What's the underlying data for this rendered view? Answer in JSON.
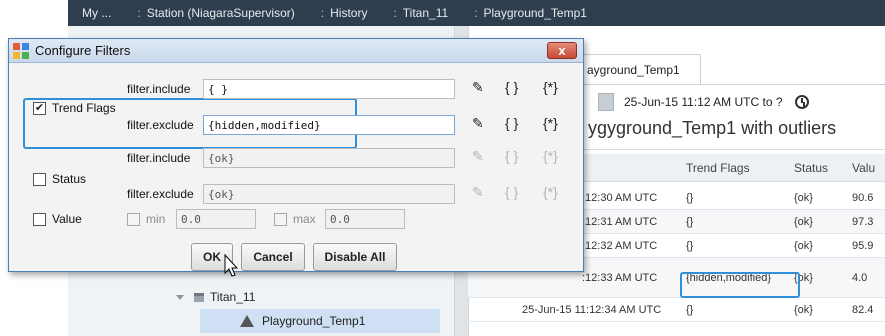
{
  "breadcrumbs": [
    {
      "label": "My ..."
    },
    {
      "label": "Station (NiagaraSupervisor)"
    },
    {
      "label": "History"
    },
    {
      "label": "Titan_11"
    },
    {
      "label": "Playground_Temp1"
    }
  ],
  "breadcrumb_separator": ":",
  "nav_tree": {
    "parent": "Titan_11",
    "selected": "Playground_Temp1"
  },
  "main": {
    "tab_label": "ayground_Temp1",
    "range_text": "25-Jun-15 11:12 AM UTC to ?",
    "chart_title": "ygyground_Temp1 with outliers",
    "columns": [
      "Trend Flags",
      "Status",
      "Valu"
    ],
    "rows": [
      {
        "timestamp": ":12:30 AM UTC",
        "flags": "{}",
        "status": "{ok}",
        "value": "90.6"
      },
      {
        "timestamp": ":12:31 AM UTC",
        "flags": "{}",
        "status": "{ok}",
        "value": "97.3"
      },
      {
        "timestamp": ":12:32 AM UTC",
        "flags": "{}",
        "status": "{ok}",
        "value": "95.9"
      },
      {
        "timestamp": ":12:33 AM UTC",
        "flags": "{hidden,modified}",
        "status": "{ok}",
        "value": "4.0"
      },
      {
        "timestamp": "25-Jun-15 11:12:34 AM UTC",
        "flags": "{}",
        "status": "{ok}",
        "value": "82.4"
      }
    ]
  },
  "dialog": {
    "title": "Configure Filters",
    "close_label": "x",
    "trend_flags": {
      "label": "Trend Flags",
      "checked": true,
      "include_label": "filter.include",
      "include_value": "{ }",
      "exclude_label": "filter.exclude",
      "exclude_value": "{hidden,modified}"
    },
    "status": {
      "label": "Status",
      "checked": false,
      "include_label": "filter.include",
      "include_value": "{ok}",
      "exclude_label": "filter.exclude",
      "exclude_value": "{ok}"
    },
    "value": {
      "label": "Value",
      "checked": false,
      "min_label": "min",
      "min_value": "0.0",
      "max_label": "max",
      "max_value": "0.0"
    },
    "icons": {
      "edit": "pencil-icon",
      "braces": "{ }",
      "star_braces": "{*}"
    },
    "buttons": {
      "ok": "OK",
      "cancel": "Cancel",
      "disable_all": "Disable All"
    }
  },
  "colors": {
    "breadcrumb_bg": "#2f3e4e",
    "highlight": "#2f8fd8",
    "close_button": "#c64b36"
  }
}
